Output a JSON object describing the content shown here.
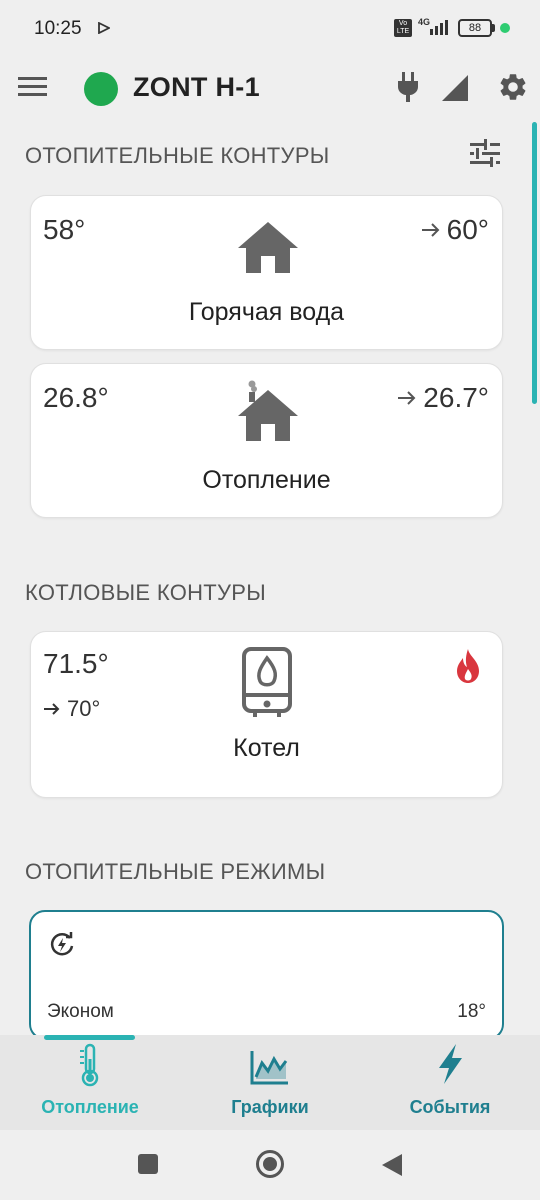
{
  "status_bar": {
    "time": "10:25",
    "volte": "Vo LTE",
    "network": "4G",
    "battery": "88"
  },
  "app_bar": {
    "title": "ZONT H-1",
    "status_color": "#1fa84f"
  },
  "sections": {
    "heating_circuits": "ОТОПИТЕЛЬНЫЕ КОНТУРЫ",
    "boiler_circuits": "КОТЛОВЫЕ КОНТУРЫ",
    "heating_modes": "ОТОПИТЕЛЬНЫЕ РЕЖИМЫ"
  },
  "heating_circuits": [
    {
      "name": "Горячая вода",
      "current": "58°",
      "target": "60°"
    },
    {
      "name": "Отопление",
      "current": "26.8°",
      "target": "26.7°"
    }
  ],
  "boiler": {
    "name": "Котел",
    "current": "71.5°",
    "target": "70°",
    "flame_color": "#d9363e"
  },
  "mode": {
    "name": "Эконом",
    "temp": "18°"
  },
  "bottom_nav": {
    "items": [
      {
        "label": "Отопление",
        "icon": "thermometer-icon",
        "active": true
      },
      {
        "label": "Графики",
        "icon": "chart-icon",
        "active": false
      },
      {
        "label": "События",
        "icon": "lightning-icon",
        "active": false
      }
    ],
    "accent": "#2bb3b3",
    "label_color": "#1f7f8f"
  }
}
